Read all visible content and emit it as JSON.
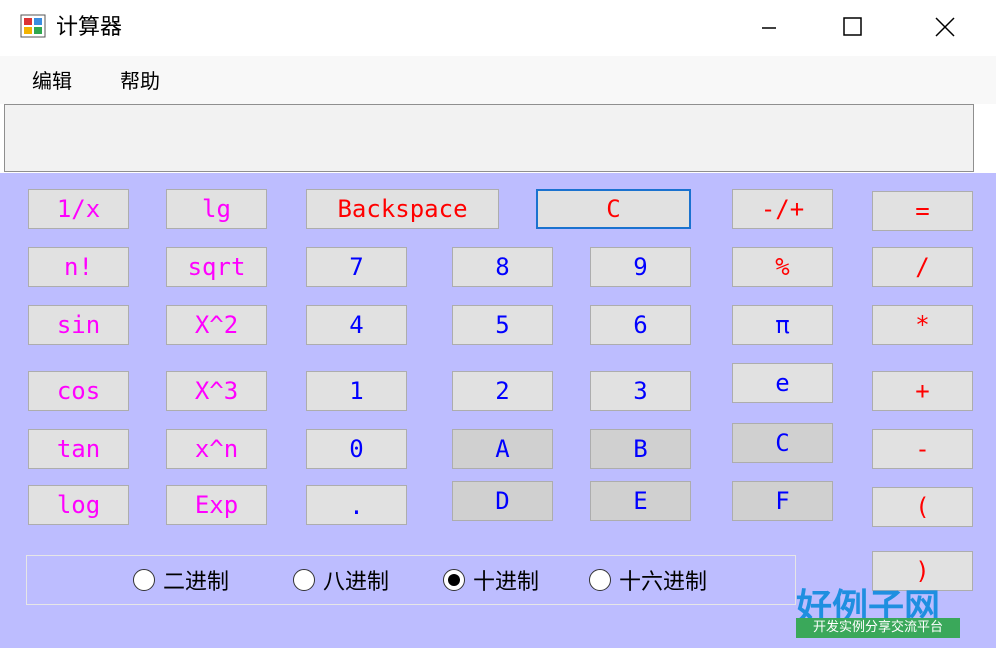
{
  "window": {
    "title": "计算器"
  },
  "menu": {
    "items": [
      "编辑",
      "帮助"
    ]
  },
  "display": {
    "value": ""
  },
  "buttons": {
    "fn": [
      "1/x",
      "lg",
      "n!",
      "sqrt",
      "sin",
      "X^2",
      "cos",
      "X^3",
      "tan",
      "x^n",
      "log",
      "Exp"
    ],
    "backspace": "Backspace",
    "clear": "C",
    "numbers": [
      "7",
      "8",
      "9",
      "4",
      "5",
      "6",
      "1",
      "2",
      "3",
      "0",
      "."
    ],
    "hex": [
      "A",
      "B",
      "C",
      "D",
      "E",
      "F"
    ],
    "special": [
      "-/+",
      "%",
      "π",
      "e"
    ],
    "ops": [
      "=",
      "/",
      "*",
      "+",
      "-",
      "(",
      ")"
    ]
  },
  "bases": {
    "options": [
      "二进制",
      "八进制",
      "十进制",
      "十六进制"
    ],
    "selected": "十进制"
  },
  "watermark": {
    "brand": "好例子网",
    "slogan": "开发实例分享交流平台"
  },
  "colors": {
    "panel": "#bdbdff",
    "fn": "#ff00ff",
    "num": "#0000ff",
    "op": "#ff0000",
    "accent": "#1a72cf"
  }
}
